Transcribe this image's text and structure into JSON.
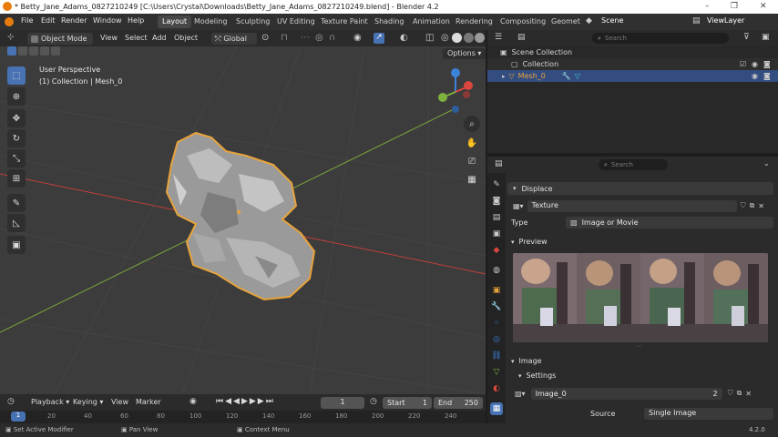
{
  "window": {
    "title": "* Betty_Jane_Adams_0827210249 [C:\\Users\\Crystal\\Downloads\\Betty_Jane_Adams_0827210249.blend] - Blender 4.2",
    "controls": [
      "–",
      "❐",
      "✕"
    ]
  },
  "menu": [
    "File",
    "Edit",
    "Render",
    "Window",
    "Help"
  ],
  "workspaces": [
    "Layout",
    "Modeling",
    "Sculpting",
    "UV Editing",
    "Texture Paint",
    "Shading",
    "Animation",
    "Rendering",
    "Compositing",
    "Geomet"
  ],
  "active_workspace": "Layout",
  "scene_label": "Scene",
  "view_layer_label": "ViewLayer",
  "viewport_header": {
    "mode": "Object Mode",
    "view": "View",
    "select": "Select",
    "add": "Add",
    "object": "Object",
    "orientation": "Global",
    "options": "Options"
  },
  "viewport": {
    "perspective": "User Perspective",
    "collection_info": "(1) Collection | Mesh_0",
    "gizmo_axes": [
      "X",
      "Y",
      "Z"
    ]
  },
  "outliner": {
    "search_placeholder": "Search",
    "scene_collection": "Scene Collection",
    "collection": "Collection",
    "object": "Mesh_0"
  },
  "properties": {
    "search_placeholder": "Search",
    "modifier": "Displace",
    "texture_label": "Texture",
    "type_label": "Type",
    "type_value": "Image or Movie",
    "preview_label": "Preview",
    "image_section": "Image",
    "settings_section": "Settings",
    "image_name": "Image_0",
    "image_users": "2",
    "source_label": "Source",
    "source_value": "Single Image"
  },
  "timeline": {
    "playback": "Playback",
    "keying": "Keying",
    "view": "View",
    "marker": "Marker",
    "current_frame": "1",
    "start_label": "Start",
    "start_value": "1",
    "end_label": "End",
    "end_value": "250",
    "ruler_ticks": [
      "1",
      "20",
      "40",
      "60",
      "80",
      "100",
      "120",
      "140",
      "160",
      "180",
      "200",
      "220",
      "240"
    ]
  },
  "statusbar": {
    "hint1": "Set Active Modifier",
    "hint2": "Pan View",
    "hint3": "Context Menu",
    "version": "4.2.0"
  },
  "colors": {
    "accent": "#4772b3",
    "selection_orange": "#e8a33b",
    "x_axis": "#d9473f",
    "y_axis": "#7fb13f",
    "z_axis": "#3d82d9"
  }
}
